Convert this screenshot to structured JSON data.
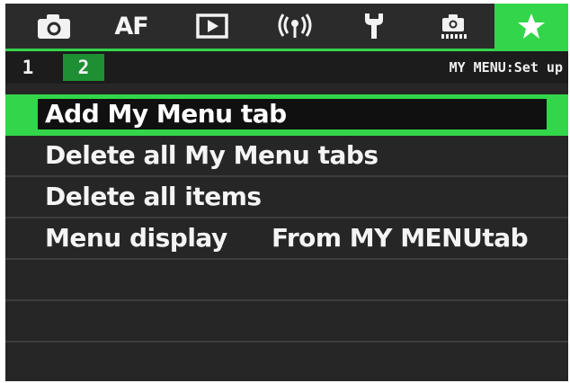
{
  "tabs": [
    {
      "name": "shooting",
      "icon": "camera-icon"
    },
    {
      "name": "af",
      "label": "AF"
    },
    {
      "name": "playback",
      "icon": "playback-icon"
    },
    {
      "name": "wireless",
      "icon": "wireless-icon"
    },
    {
      "name": "setup",
      "icon": "wrench-icon"
    },
    {
      "name": "custom-functions",
      "icon": "custom-function-icon"
    },
    {
      "name": "my-menu",
      "icon": "star-icon",
      "active": true
    }
  ],
  "subtabs": [
    {
      "label": "1",
      "active": false
    },
    {
      "label": "2",
      "active": true
    }
  ],
  "page_title": "MY MENU:Set up",
  "menu_items": [
    {
      "label": "Add My Menu tab",
      "value": "",
      "selected": true
    },
    {
      "label": "Delete all My Menu tabs",
      "value": ""
    },
    {
      "label": "Delete all items",
      "value": ""
    },
    {
      "label": "Menu display",
      "value": "From MY MENUtab"
    }
  ],
  "colors": {
    "accent": "#33d64a",
    "subtab_active": "#1f8f34",
    "background": "#262626",
    "text": "#f4f4f4"
  }
}
